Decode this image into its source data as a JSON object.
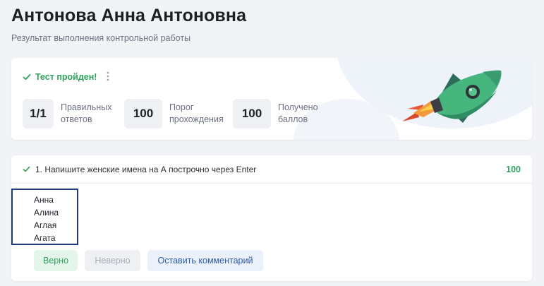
{
  "header": {
    "title": "Антонова Анна Антоновна",
    "subtitle": "Результат выполнения контрольной работы"
  },
  "result": {
    "status": "Тест пройден!",
    "status_icon": "check-icon",
    "menu_icon": "more-vertical-icon",
    "stats": [
      {
        "value": "1/1",
        "label_line1": "Правильных",
        "label_line2": "ответов"
      },
      {
        "value": "100",
        "label_line1": "Порог",
        "label_line2": "прохождения"
      },
      {
        "value": "100",
        "label_line1": "Получено",
        "label_line2": "баллов"
      }
    ],
    "illustration": "rocket-icon"
  },
  "question": {
    "text": "1. Напишите женские имена на А построчно через Enter",
    "score": "100",
    "answers": [
      "Анна",
      "Алина",
      "Аглая",
      "Агата"
    ],
    "buttons": {
      "correct": "Верно",
      "wrong": "Неверно",
      "comment": "Оставить комментарий"
    }
  },
  "colors": {
    "success": "#2fa15a",
    "background": "#f1f3f7",
    "answer_border": "#1f3a78",
    "link_blue": "#2f5aa8"
  }
}
